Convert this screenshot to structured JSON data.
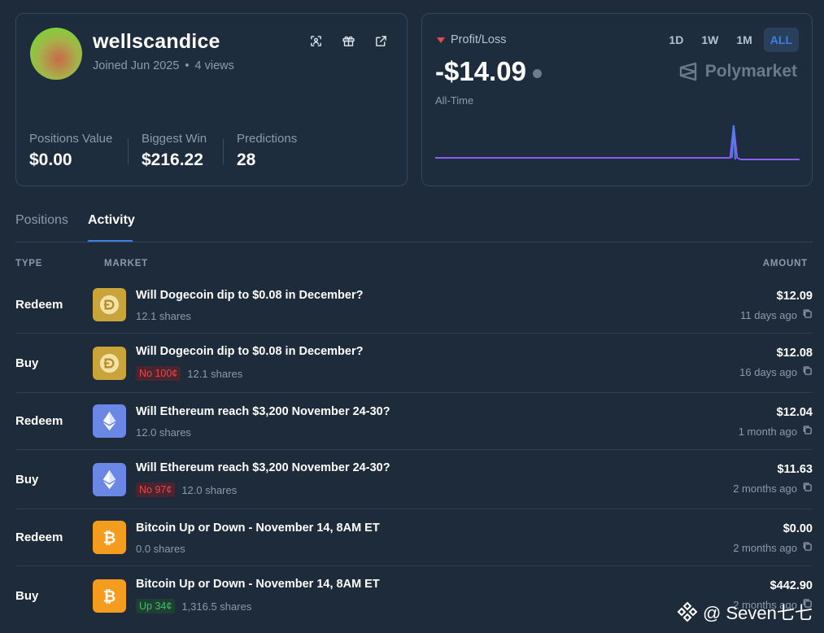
{
  "profile": {
    "username": "wellscandice",
    "joined": "Joined Jun 2025",
    "separator": "•",
    "views": "4 views",
    "stats": [
      {
        "label": "Positions Value",
        "value": "$0.00"
      },
      {
        "label": "Biggest Win",
        "value": "$216.22"
      },
      {
        "label": "Predictions",
        "value": "28"
      }
    ],
    "actions": [
      "scan-icon",
      "gift-icon",
      "external-link-icon"
    ]
  },
  "pnl": {
    "label": "Profit/Loss",
    "value": "-$14.09",
    "range_label": "All-Time",
    "ranges": [
      "1D",
      "1W",
      "1M",
      "ALL"
    ],
    "active_range": "ALL",
    "brand": "Polymarket",
    "colors": {
      "negative": "#e5484d",
      "line": "#8b5cf6",
      "spike": "#4f7ee8"
    },
    "sparkline": [
      0,
      0,
      0,
      0,
      0,
      0,
      0,
      0,
      0,
      0,
      0,
      0,
      0,
      0,
      0,
      0,
      0,
      0,
      0,
      0,
      0,
      0,
      0,
      0,
      0,
      0,
      0,
      0,
      0,
      0,
      0,
      0,
      0,
      0,
      0,
      0,
      0,
      0,
      0,
      0,
      0,
      0,
      0,
      0,
      0,
      0,
      0,
      0,
      0,
      0,
      0,
      0,
      0,
      0,
      0,
      0,
      0,
      0,
      0,
      0,
      0,
      0,
      0,
      0,
      0,
      0,
      0,
      0,
      0,
      0,
      0,
      0,
      0,
      0,
      0,
      0,
      0,
      0,
      0,
      0,
      0,
      0,
      0,
      0,
      0,
      0,
      1,
      0,
      -0.05,
      -0.05,
      -0.05,
      -0.05,
      -0.05,
      -0.05,
      -0.05,
      -0.05,
      -0.05,
      -0.05,
      -0.05,
      -0.05,
      -0.05,
      -0.05,
      -0.05,
      -0.05,
      -0.05,
      -0.05
    ]
  },
  "tabs": [
    {
      "label": "Positions",
      "active": false
    },
    {
      "label": "Activity",
      "active": true
    }
  ],
  "table": {
    "headers": {
      "type": "TYPE",
      "market": "MARKET",
      "amount": "AMOUNT"
    },
    "rows": [
      {
        "type": "Redeem",
        "coin": "doge",
        "title": "Will Dogecoin dip to $0.08 in December?",
        "pill": "",
        "pill_kind": "",
        "shares": "12.1 shares",
        "amount": "$12.09",
        "when": "11 days ago"
      },
      {
        "type": "Buy",
        "coin": "doge",
        "title": "Will Dogecoin dip to $0.08 in December?",
        "pill": "No 100¢",
        "pill_kind": "no",
        "shares": "12.1 shares",
        "amount": "$12.08",
        "when": "16 days ago"
      },
      {
        "type": "Redeem",
        "coin": "eth",
        "title": "Will Ethereum reach $3,200 November 24-30?",
        "pill": "",
        "pill_kind": "",
        "shares": "12.0 shares",
        "amount": "$12.04",
        "when": "1 month ago"
      },
      {
        "type": "Buy",
        "coin": "eth",
        "title": "Will Ethereum reach $3,200 November 24-30?",
        "pill": "No 97¢",
        "pill_kind": "no",
        "shares": "12.0 shares",
        "amount": "$11.63",
        "when": "2 months ago"
      },
      {
        "type": "Redeem",
        "coin": "btc",
        "title": "Bitcoin Up or Down - November 14, 8AM ET",
        "pill": "",
        "pill_kind": "",
        "shares": "0.0 shares",
        "amount": "$0.00",
        "when": "2 months ago"
      },
      {
        "type": "Buy",
        "coin": "btc",
        "title": "Bitcoin Up or Down - November 14, 8AM ET",
        "pill": "Up 34¢",
        "pill_kind": "up",
        "shares": "1,316.5 shares",
        "amount": "$442.90",
        "when": "2 months ago"
      }
    ]
  },
  "watermark": "@ Seven七七"
}
